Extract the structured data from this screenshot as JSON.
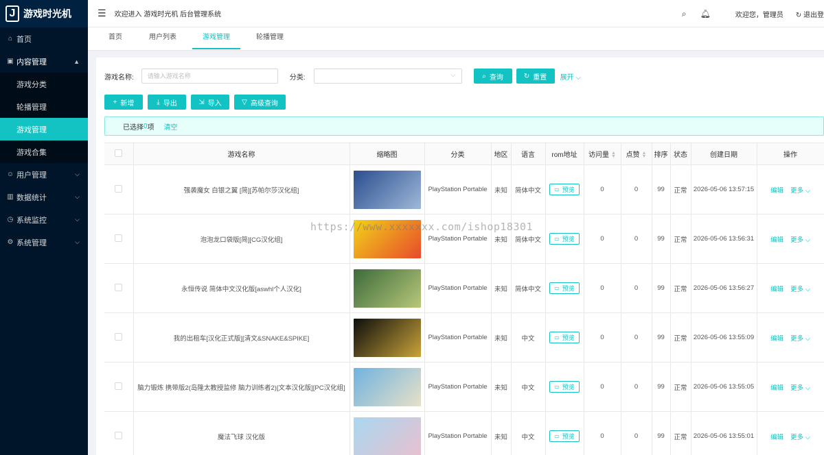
{
  "sidebar": {
    "logo_letter": "J",
    "logo_text": "游戏时光机",
    "items": [
      {
        "label": "首页",
        "icon": "home-icon",
        "glyph": "⌂"
      },
      {
        "label": "内容管理",
        "icon": "content-icon",
        "glyph": "▣",
        "open": true,
        "children": [
          {
            "label": "游戏分类"
          },
          {
            "label": "轮播管理"
          },
          {
            "label": "游戏管理",
            "active": true
          },
          {
            "label": "游戏合集"
          }
        ]
      },
      {
        "label": "用户管理",
        "icon": "user-icon",
        "glyph": "☺"
      },
      {
        "label": "数据统计",
        "icon": "chart-icon",
        "glyph": "▥"
      },
      {
        "label": "系统监控",
        "icon": "monitor-icon",
        "glyph": "◷"
      },
      {
        "label": "系统管理",
        "icon": "settings-icon",
        "glyph": "⚙"
      }
    ]
  },
  "header": {
    "welcome_system": "欢迎进入 游戏时光机 后台管理系统",
    "welcome_user": "欢迎您，管理员",
    "logout": "退出登"
  },
  "tabs": [
    {
      "label": "首页"
    },
    {
      "label": "用户列表"
    },
    {
      "label": "游戏管理",
      "active": true
    },
    {
      "label": "轮播管理"
    }
  ],
  "search": {
    "name_label": "游戏名称:",
    "name_placeholder": "请输入游戏名称",
    "category_label": "分类:",
    "category_value": "",
    "query_button": "查询",
    "reset_button": "重置",
    "expand_link": "展开"
  },
  "toolbar": {
    "add": "新增",
    "export": "导出",
    "import": "导入",
    "advanced": "高级查询"
  },
  "selection": {
    "prefix": "已选择 ",
    "count": "0",
    "suffix": "项",
    "clear": "清空"
  },
  "table": {
    "columns": [
      "游戏名称",
      "缩略图",
      "分类",
      "地区",
      "语言",
      "rom地址",
      "访问量",
      "点赞",
      "排序",
      "状态",
      "创建日期",
      "操作"
    ],
    "preview_label": "预览",
    "edit_label": "编辑",
    "more_label": "更多",
    "rows": [
      {
        "name": "强袭魔女 白银之翼 [简][苏帕尔莎汉化组]",
        "category": "PlayStation Portable",
        "region": "未知",
        "language": "简体中文",
        "visits": "0",
        "likes": "0",
        "sort": "99",
        "status": "正常",
        "created": "2026-05-06 13:57:15",
        "thumb_colors": [
          "#2a4e8f",
          "#9fb8d8"
        ]
      },
      {
        "name": "泡泡龙口袋版[简][CG汉化组]",
        "category": "PlayStation Portable",
        "region": "未知",
        "language": "简体中文",
        "visits": "0",
        "likes": "0",
        "sort": "99",
        "status": "正常",
        "created": "2026-05-06 13:56:31",
        "thumb_colors": [
          "#f2d21a",
          "#e84a2b"
        ]
      },
      {
        "name": "永恒传说 简体中文汉化版[aswhl个人汉化]",
        "category": "PlayStation Portable",
        "region": "未知",
        "language": "简体中文",
        "visits": "0",
        "likes": "0",
        "sort": "99",
        "status": "正常",
        "created": "2026-05-06 13:56:27",
        "thumb_colors": [
          "#3c6b3a",
          "#b8c77a"
        ]
      },
      {
        "name": "我的出租车[汉化正式版][清文&SNAKE&SPIKE]",
        "category": "PlayStation Portable",
        "region": "未知",
        "language": "中文",
        "visits": "0",
        "likes": "0",
        "sort": "99",
        "status": "正常",
        "created": "2026-05-06 13:55:09",
        "thumb_colors": [
          "#0d0d0d",
          "#c9a43a"
        ]
      },
      {
        "name": "脑力锻炼 携带版2(岛隆太教授监修 脑力训练者2)[文本汉化版][PC汉化组]",
        "category": "PlayStation Portable",
        "region": "未知",
        "language": "中文",
        "visits": "0",
        "likes": "0",
        "sort": "99",
        "status": "正常",
        "created": "2026-05-06 13:55:05",
        "thumb_colors": [
          "#6fb3e0",
          "#e8e0c8"
        ]
      },
      {
        "name": "魔法飞球 汉化版",
        "category": "PlayStation Portable",
        "region": "未知",
        "language": "中文",
        "visits": "0",
        "likes": "0",
        "sort": "99",
        "status": "正常",
        "created": "2026-05-06 13:55:01",
        "thumb_colors": [
          "#a8d8f0",
          "#e8c0d0"
        ]
      }
    ]
  },
  "watermark": "https://www.xxxxxxx.com/ishop18301"
}
